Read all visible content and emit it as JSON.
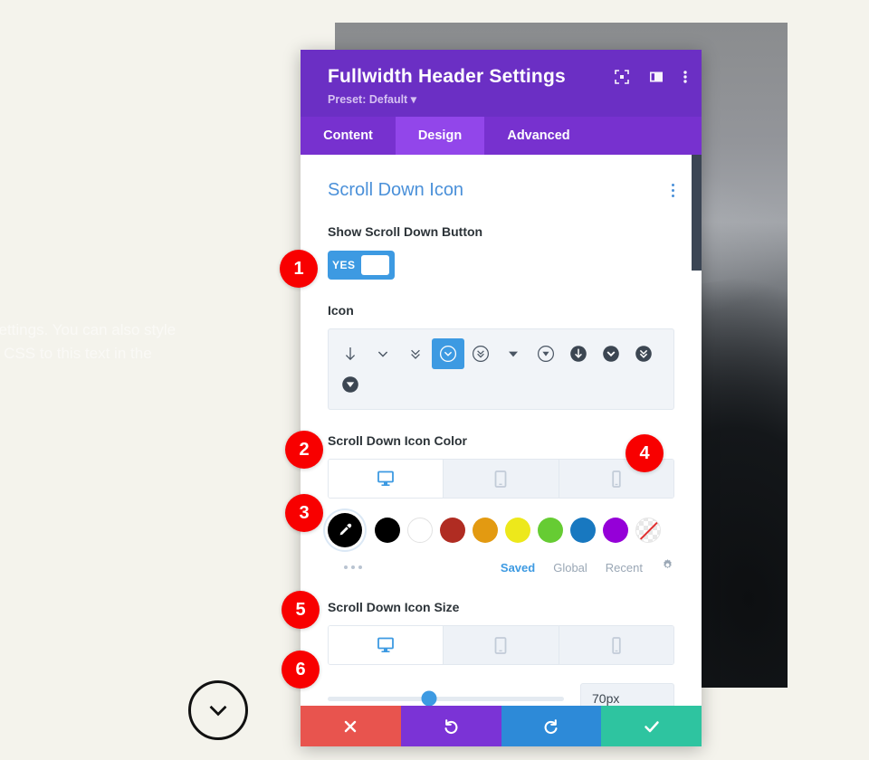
{
  "page": {
    "background_color": "#f4f3ec",
    "hero_text": "settings. You can also style\nn CSS to this text in the",
    "scroll_down_icon": "circle-chevron-down-icon"
  },
  "modal": {
    "title": "Fullwidth Header Settings",
    "preset": "Preset: Default",
    "header_icons": [
      {
        "name": "expand-icon"
      },
      {
        "name": "layout-panel-icon"
      },
      {
        "name": "more-vertical-icon"
      }
    ],
    "tabs": [
      {
        "label": "Content",
        "active": false
      },
      {
        "label": "Design",
        "active": true
      },
      {
        "label": "Advanced",
        "active": false
      }
    ],
    "accent_purple": "#6b2fc4",
    "tab_active_color": "#9246ea"
  },
  "section": {
    "title": "Scroll Down Icon",
    "menu_icon": "more-vertical-icon",
    "title_color": "#4a90d9"
  },
  "show_scroll_down": {
    "label": "Show Scroll Down Button",
    "toggle_value": "YES",
    "toggle_on": true,
    "toggle_color": "#3d9ae2"
  },
  "icon_field": {
    "label": "Icon",
    "selected_index": 3,
    "icons": [
      {
        "name": "arrow-down-icon"
      },
      {
        "name": "chevron-down-icon"
      },
      {
        "name": "double-chevron-down-icon"
      },
      {
        "name": "circle-outline-chevron-down-icon"
      },
      {
        "name": "circle-outline-double-chevron-down-icon"
      },
      {
        "name": "triangle-down-icon"
      },
      {
        "name": "circle-outline-triangle-down-icon"
      },
      {
        "name": "circle-filled-arrow-down-icon"
      },
      {
        "name": "circle-filled-chevron-down-icon"
      },
      {
        "name": "circle-filled-double-chevron-down-icon"
      },
      {
        "name": "circle-filled-triangle-down-icon"
      }
    ]
  },
  "icon_color": {
    "label": "Scroll Down Icon Color",
    "devices": [
      {
        "name": "desktop-icon",
        "active": true
      },
      {
        "name": "tablet-icon",
        "active": false
      },
      {
        "name": "phone-icon",
        "active": false
      }
    ],
    "selected_swatch_icon": "eyedropper-icon",
    "selected_swatch_color": "#000000",
    "swatches": [
      {
        "name": "black",
        "color": "#000000"
      },
      {
        "name": "white",
        "color": "#ffffff"
      },
      {
        "name": "dark-red",
        "color": "#b02c22"
      },
      {
        "name": "orange",
        "color": "#e39a11"
      },
      {
        "name": "yellow",
        "color": "#ede81b"
      },
      {
        "name": "green",
        "color": "#66cc33"
      },
      {
        "name": "blue",
        "color": "#1878c0"
      },
      {
        "name": "purple",
        "color": "#9500d8"
      },
      {
        "name": "transparent",
        "color": "none"
      }
    ],
    "palette_tabs": [
      {
        "label": "Saved",
        "active": true
      },
      {
        "label": "Global",
        "active": false
      },
      {
        "label": "Recent",
        "active": false
      }
    ],
    "settings_icon": "gear-icon",
    "more_icon": "more-horizontal-icon"
  },
  "icon_size": {
    "label": "Scroll Down Icon Size",
    "devices": [
      {
        "name": "desktop-icon",
        "active": true
      },
      {
        "name": "tablet-icon",
        "active": false
      },
      {
        "name": "phone-icon",
        "active": false
      }
    ],
    "value": "70px",
    "slider_percent": 43
  },
  "footer_buttons": [
    {
      "name": "cancel-button",
      "icon": "close-icon",
      "color": "#e8544e"
    },
    {
      "name": "undo-button",
      "icon": "undo-icon",
      "color": "#7b33d6"
    },
    {
      "name": "redo-button",
      "icon": "redo-icon",
      "color": "#2d8ad8"
    },
    {
      "name": "save-button",
      "icon": "check-icon",
      "color": "#2ec4a0"
    }
  ],
  "badges": [
    {
      "number": "1"
    },
    {
      "number": "2"
    },
    {
      "number": "3"
    },
    {
      "number": "4"
    },
    {
      "number": "5"
    },
    {
      "number": "6"
    }
  ]
}
